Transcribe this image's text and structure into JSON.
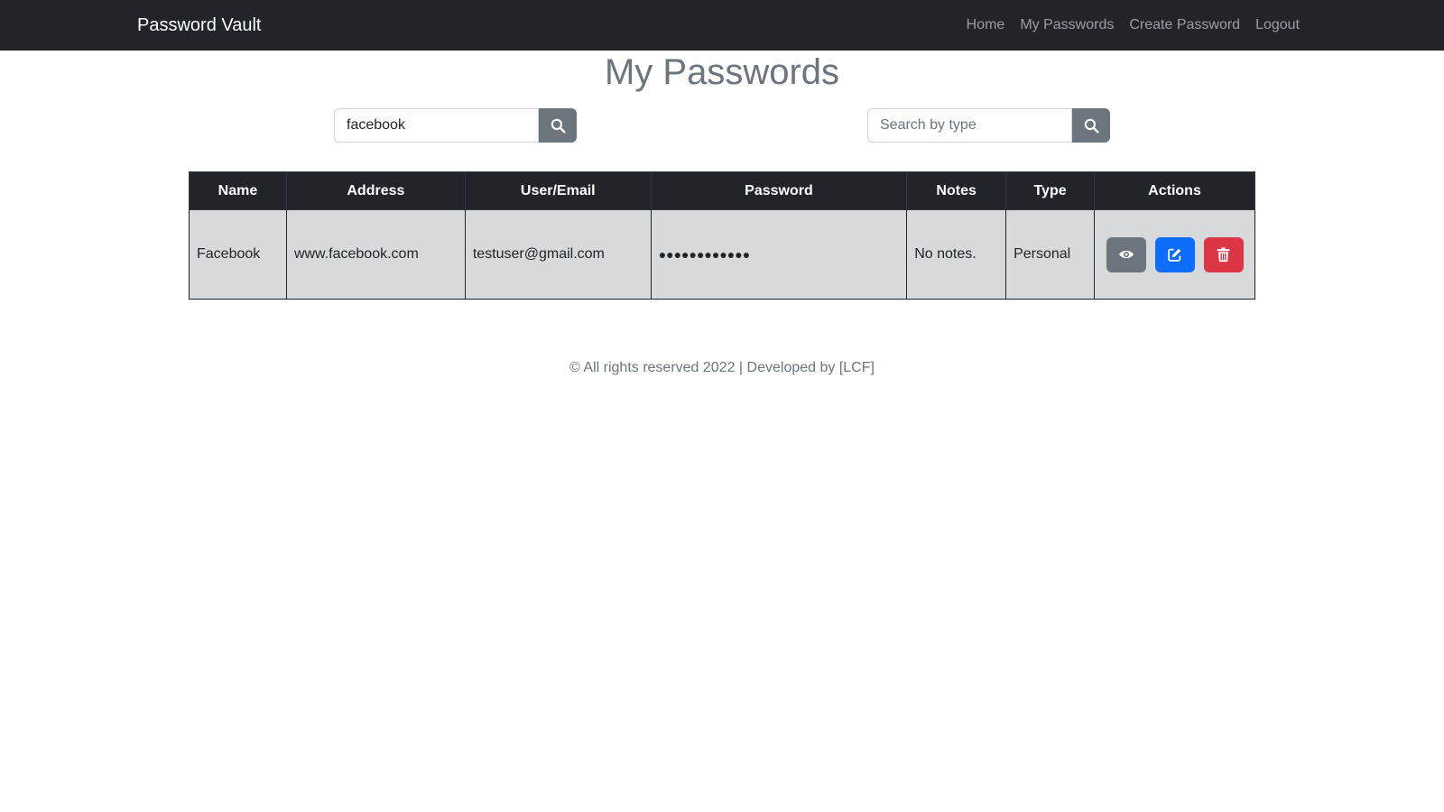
{
  "navbar": {
    "brand": "Password Vault",
    "links": [
      "Home",
      "My Passwords",
      "Create Password",
      "Logout"
    ]
  },
  "page": {
    "title": "My Passwords"
  },
  "search": {
    "name_value": "facebook",
    "type_placeholder": "Search by type",
    "type_value": ""
  },
  "table": {
    "headers": [
      "Name",
      "Address",
      "User/Email",
      "Password",
      "Notes",
      "Type",
      "Actions"
    ],
    "rows": [
      {
        "name": "Facebook",
        "address": "www.facebook.com",
        "user": "testuser@gmail.com",
        "password": "●●●●●●●●●●●●",
        "notes": "No notes.",
        "type": "Personal",
        "actions": [
          "eye-icon",
          "edit-icon",
          "trash-icon"
        ]
      }
    ]
  },
  "footer": {
    "text": "© All rights reserved 2022 | Developed by [LCF]"
  },
  "colors": {
    "navbar": "#212529",
    "secondary": "#6c757d",
    "primary": "#0d6efd",
    "danger": "#dc3545",
    "row_bg": "#d8d9da"
  }
}
